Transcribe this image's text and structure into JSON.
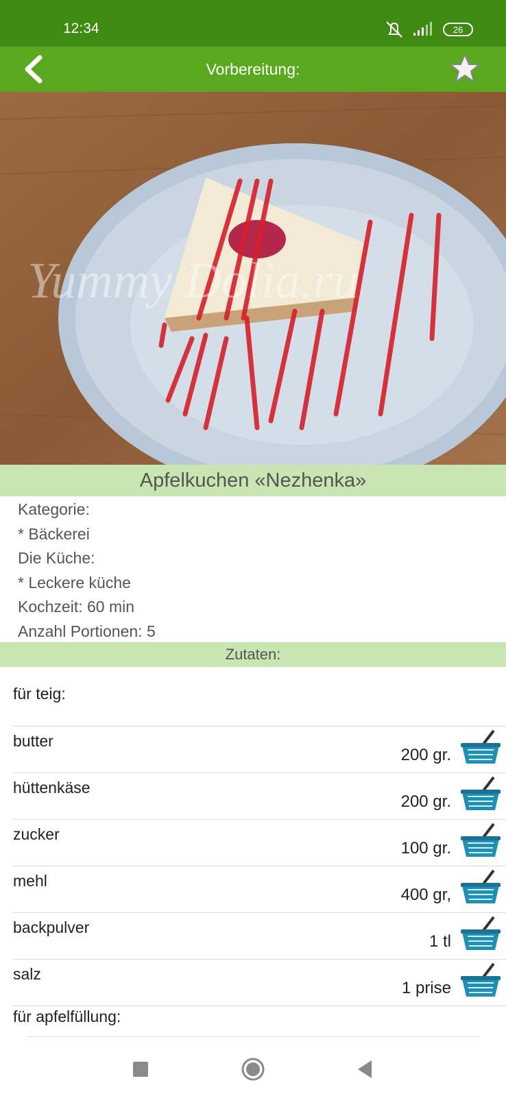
{
  "status_bar": {
    "time": "12:34",
    "battery": "26"
  },
  "app_bar": {
    "title": "Vorbereitung:"
  },
  "hero": {
    "watermark": "Yummy Dolia.ru"
  },
  "recipe": {
    "title": "Apfelkuchen «Nezhenka»",
    "meta": [
      "Kategorie:",
      "* Bäckerei",
      "Die Küche:",
      "* Leckere küche",
      "Kochzeit: 60 min",
      "Anzahl Portionen: 5"
    ]
  },
  "ingredients": {
    "section_label": "Zutaten:",
    "group1": "für teig:",
    "items": [
      {
        "name": "butter",
        "amount": "200 gr."
      },
      {
        "name": "hüttenkäse",
        "amount": "200 gr."
      },
      {
        "name": "zucker",
        "amount": "100 gr."
      },
      {
        "name": "mehl",
        "amount": "400 gr,"
      },
      {
        "name": "backpulver",
        "amount": "1 tl"
      },
      {
        "name": "salz",
        "amount": "1 prise"
      }
    ],
    "group2": "für apfelfüllung:"
  },
  "icons": {
    "back": "chevron-left-icon",
    "favorite": "star-icon",
    "basket": "shopping-basket-icon",
    "nav_recents": "square-icon",
    "nav_home": "circle-icon",
    "nav_back": "triangle-left-icon"
  },
  "colors": {
    "statusbar": "#3f8a12",
    "appbar": "#5aa81d",
    "band": "#c9e5b1",
    "basket": "#1f8fb5"
  }
}
